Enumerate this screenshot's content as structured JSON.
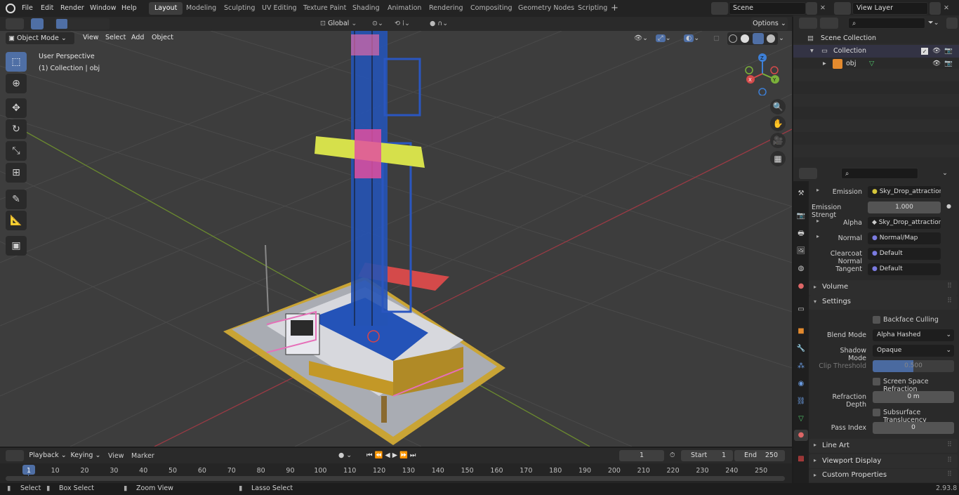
{
  "topmenu": [
    "File",
    "Edit",
    "Render",
    "Window",
    "Help"
  ],
  "workspaces": [
    "Layout",
    "Modeling",
    "Sculpting",
    "UV Editing",
    "Texture Paint",
    "Shading",
    "Animation",
    "Rendering",
    "Compositing",
    "Geometry Nodes",
    "Scripting"
  ],
  "scene_name": "Scene",
  "view_layer": "View Layer",
  "toolbar": {
    "orientation": "Global",
    "options": "Options"
  },
  "viewport_header": {
    "mode": "Object Mode",
    "menus": [
      "View",
      "Select",
      "Add",
      "Object"
    ]
  },
  "viewport_overlay": {
    "perspective": "User Perspective",
    "collection": "(1) Collection | obj"
  },
  "gizmo": {
    "x": "X",
    "y": "Y",
    "z": "Z"
  },
  "outliner": {
    "root": "Scene Collection",
    "collection": "Collection",
    "object": "obj"
  },
  "properties": {
    "rows": [
      {
        "label": "Emission",
        "value": "Sky_Drop_attraction..."
      },
      {
        "label": "Emission Strengt",
        "value": "1.000"
      },
      {
        "label": "Alpha",
        "value": "Sky_Drop_attraction..."
      },
      {
        "label": "Normal",
        "value": "Normal/Map"
      },
      {
        "label": "Clearcoat Normal",
        "value": "Default"
      },
      {
        "label": "Tangent",
        "value": "Default"
      }
    ],
    "volume": "Volume",
    "settings": "Settings",
    "backface": "Backface Culling",
    "blend_label": "Blend Mode",
    "blend_value": "Alpha Hashed",
    "shadow_label": "Shadow Mode",
    "shadow_value": "Opaque",
    "clip_label": "Clip Threshold",
    "clip_value": "0.500",
    "ssr": "Screen Space Refraction",
    "refr_label": "Refraction Depth",
    "refr_value": "0 m",
    "sss": "Subsurface Translucency",
    "pass_label": "Pass Index",
    "pass_value": "0",
    "line_art": "Line Art",
    "viewport_display": "Viewport Display",
    "custom_props": "Custom Properties"
  },
  "timeline": {
    "menus": [
      "Playback",
      "Keying",
      "View",
      "Marker"
    ],
    "current": "1",
    "start_label": "Start",
    "start": "1",
    "end_label": "End",
    "end": "250",
    "frames": [
      "1",
      "10",
      "20",
      "30",
      "40",
      "50",
      "60",
      "70",
      "80",
      "90",
      "100",
      "110",
      "120",
      "130",
      "140",
      "150",
      "160",
      "170",
      "180",
      "190",
      "200",
      "210",
      "220",
      "230",
      "240",
      "250"
    ]
  },
  "status": {
    "select": "Select",
    "box": "Box Select",
    "zoom": "Zoom View",
    "lasso": "Lasso Select",
    "version": "2.93.8"
  }
}
